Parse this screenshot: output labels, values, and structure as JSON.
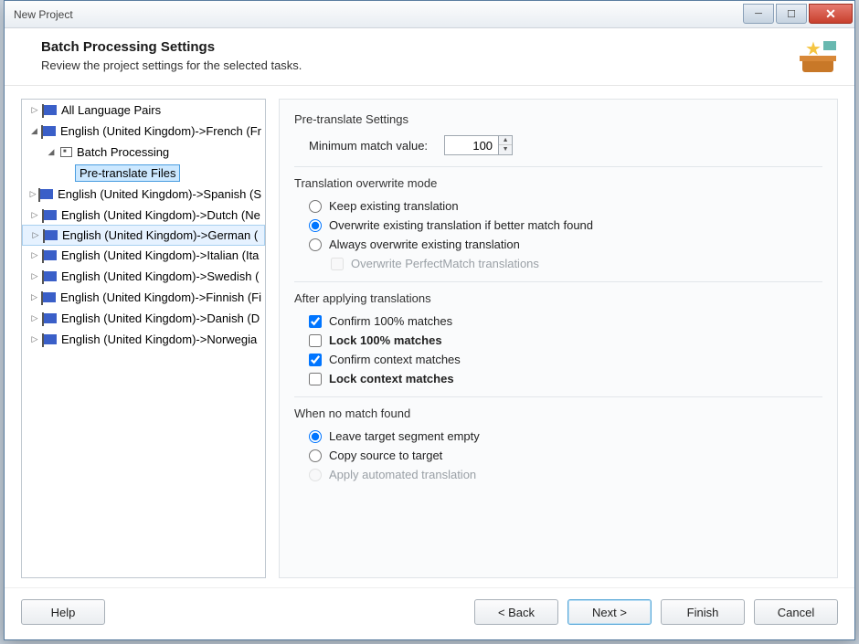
{
  "window": {
    "title": "New Project"
  },
  "header": {
    "title": "Batch Processing Settings",
    "subtitle": "Review the project settings for the selected tasks."
  },
  "tree": {
    "items": [
      {
        "label": "All Language Pairs",
        "depth": 0,
        "expander": "▷",
        "icon": "flag"
      },
      {
        "label": "English (United Kingdom)->French (Fr",
        "depth": 0,
        "expander": "◢",
        "icon": "flag"
      },
      {
        "label": "Batch Processing",
        "depth": 1,
        "expander": "◢",
        "icon": "folder"
      },
      {
        "label": "Pre-translate Files",
        "depth": 2,
        "expander": "",
        "icon": "none",
        "selbox": true
      },
      {
        "label": "English (United Kingdom)->Spanish (S",
        "depth": 0,
        "expander": "▷",
        "icon": "flag"
      },
      {
        "label": "English (United Kingdom)->Dutch (Ne",
        "depth": 0,
        "expander": "▷",
        "icon": "flag"
      },
      {
        "label": "English (United Kingdom)->German (",
        "depth": 0,
        "expander": "▷",
        "icon": "flag",
        "row_hl": true
      },
      {
        "label": "English (United Kingdom)->Italian (Ita",
        "depth": 0,
        "expander": "▷",
        "icon": "flag"
      },
      {
        "label": "English (United Kingdom)->Swedish (",
        "depth": 0,
        "expander": "▷",
        "icon": "flag"
      },
      {
        "label": "English (United Kingdom)->Finnish (Fi",
        "depth": 0,
        "expander": "▷",
        "icon": "flag"
      },
      {
        "label": "English (United Kingdom)->Danish (D",
        "depth": 0,
        "expander": "▷",
        "icon": "flag"
      },
      {
        "label": "English (United Kingdom)->Norwegia",
        "depth": 0,
        "expander": "▷",
        "icon": "flag"
      }
    ]
  },
  "settings": {
    "pretranslate_title": "Pre-translate Settings",
    "min_match_label": "Minimum match value:",
    "min_match_value": "100",
    "overwrite_title": "Translation overwrite mode",
    "overwrite": {
      "keep": "Keep existing translation",
      "better": "Overwrite existing translation if better match found",
      "always": "Always overwrite existing translation",
      "perfectmatch": "Overwrite PerfectMatch translations"
    },
    "after_title": "After applying translations",
    "after": {
      "confirm100": "Confirm 100% matches",
      "lock100": "Lock 100% matches",
      "confirmctx": "Confirm context matches",
      "lockctx": "Lock context matches"
    },
    "nomatch_title": "When no match found",
    "nomatch": {
      "empty": "Leave target segment empty",
      "copy": "Copy source to target",
      "auto": "Apply automated translation"
    }
  },
  "footer": {
    "help": "Help",
    "back": "< Back",
    "next": "Next >",
    "finish": "Finish",
    "cancel": "Cancel"
  }
}
